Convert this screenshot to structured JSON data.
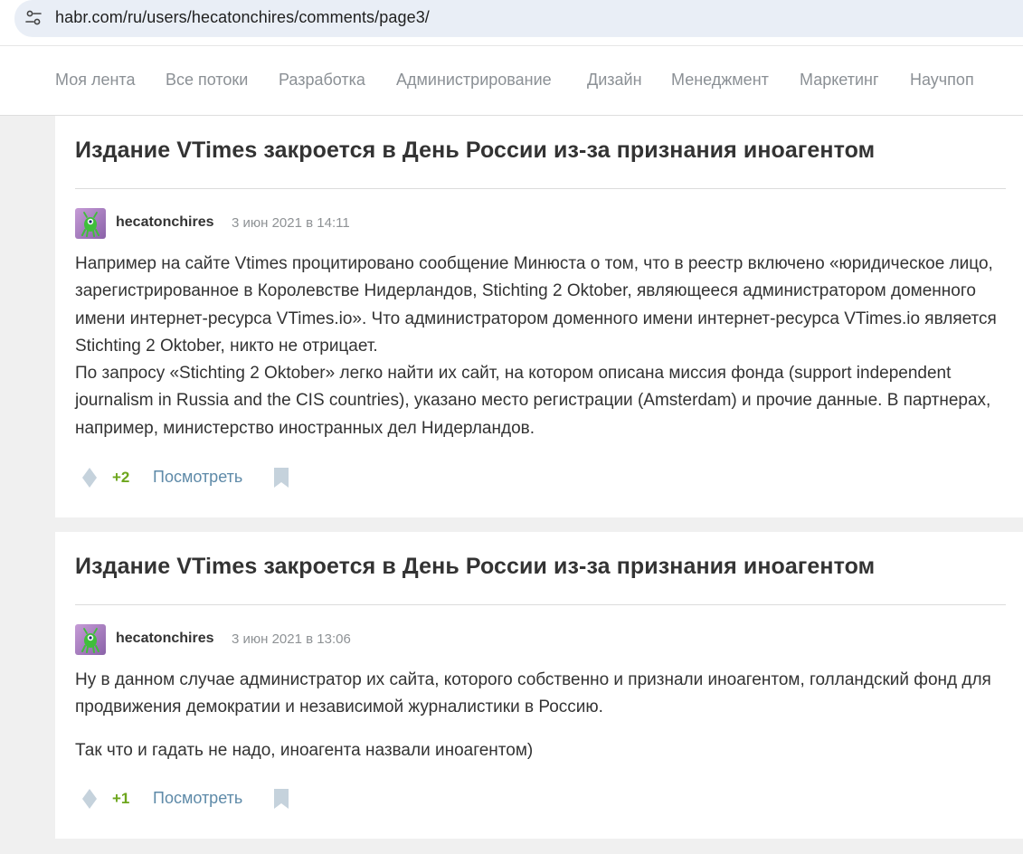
{
  "browser": {
    "url": "habr.com/ru/users/hecatonchires/comments/page3/",
    "site_settings_icon": "tune-icon"
  },
  "nav": {
    "items": [
      {
        "label": "Моя лента"
      },
      {
        "label": "Все потоки"
      },
      {
        "label": "Разработка"
      },
      {
        "label": "Администрирование"
      },
      {
        "label": "Дизайн"
      },
      {
        "label": "Менеджмент"
      },
      {
        "label": "Маркетинг"
      },
      {
        "label": "Научпоп"
      }
    ]
  },
  "colors": {
    "score_positive": "#6da61d",
    "link": "#5e8aa8",
    "muted": "#8b9095"
  },
  "comments": [
    {
      "article_title": "Издание VTimes закроется в День России из-за признания иноагентом",
      "author": "hecatonchires",
      "date": "3 июн 2021 в 14:11",
      "paragraphs": [
        "Например на сайте Vtimes процитировано сообщение Минюста о том, что в реестр включено «юридическое лицо, зарегистрированное в Королевстве Нидерландов, Stichting 2 Oktober, являющееся администратором доменного имени интернет-ресурса VTimes.io». Что администратором доменного имени интернет-ресурса VTimes.io является Stichting 2 Oktober, никто не отрицает.",
        "По запросу «Stichting 2 Oktober» легко найти их сайт, на котором описана миссия фонда (support independent journalism in Russia and the CIS countries), указано место регистрации (Amsterdam) и прочие данные. В партнерах, например, министерство иностранных дел Нидерландов."
      ],
      "score": "+2",
      "view_label": "Посмотреть"
    },
    {
      "article_title": "Издание VTimes закроется в День России из-за признания иноагентом",
      "author": "hecatonchires",
      "date": "3 июн 2021 в 13:06",
      "paragraphs": [
        "Ну в данном случае администратор их сайта, которого собственно и признали иноагентом, голландский фонд для продвижения демократии и независимой журналистики в Россию.",
        "Так что и гадать не надо, иноагента назвали иноагентом)"
      ],
      "score": "+1",
      "view_label": "Посмотреть"
    }
  ]
}
